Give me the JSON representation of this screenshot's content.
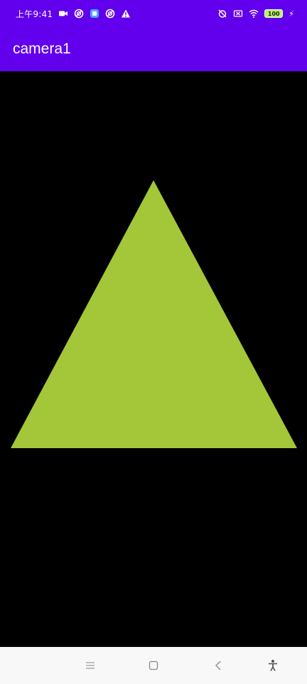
{
  "status_bar": {
    "time": "上午9:41",
    "battery_level": "100",
    "left_icons": [
      "video-camera-icon",
      "sync-icon",
      "app-notification-icon",
      "sync-icon",
      "warning-icon"
    ],
    "right_icons": [
      "alarm-off-icon",
      "sim-off-icon",
      "wifi-icon",
      "battery-icon",
      "charging-icon"
    ]
  },
  "app_bar": {
    "title": "camera1",
    "background_color": "#6200ee"
  },
  "canvas": {
    "background_color": "#000000",
    "shape": "triangle",
    "shape_color": "#a4c639"
  },
  "nav_bar": {
    "buttons": [
      "menu-icon",
      "home-icon",
      "back-icon",
      "accessibility-icon"
    ]
  }
}
